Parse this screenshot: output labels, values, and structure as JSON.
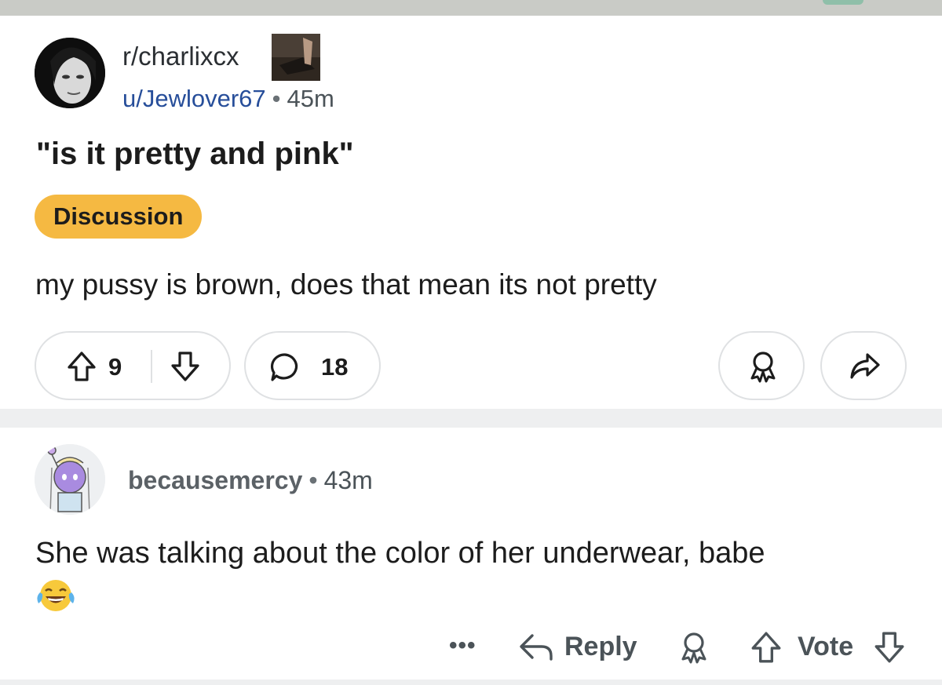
{
  "post": {
    "subreddit": "r/charlixcx",
    "username": "u/Jewlover67",
    "time": "45m",
    "title": "\"is it pretty and pink\"",
    "flair": "Discussion",
    "body": "my pussy is brown, does that mean its not pretty",
    "score": "9",
    "comment_count": "18"
  },
  "comment": {
    "username": "becausemercy",
    "time": "43m",
    "body": "She was talking about the color of her underwear, babe",
    "emoji": "😂",
    "more_label": "•••",
    "reply_label": "Reply",
    "vote_label": "Vote"
  },
  "meta_separator": "•",
  "colors": {
    "flair_bg": "#f5b942",
    "user_link": "#274e9a",
    "pill_border": "#dfe1e3",
    "separator_bg": "#eeeff0"
  },
  "icons": [
    "upvote-icon",
    "downvote-icon",
    "comment-icon",
    "award-icon",
    "share-icon",
    "reply-icon",
    "more-icon",
    "laughing-emoji"
  ]
}
